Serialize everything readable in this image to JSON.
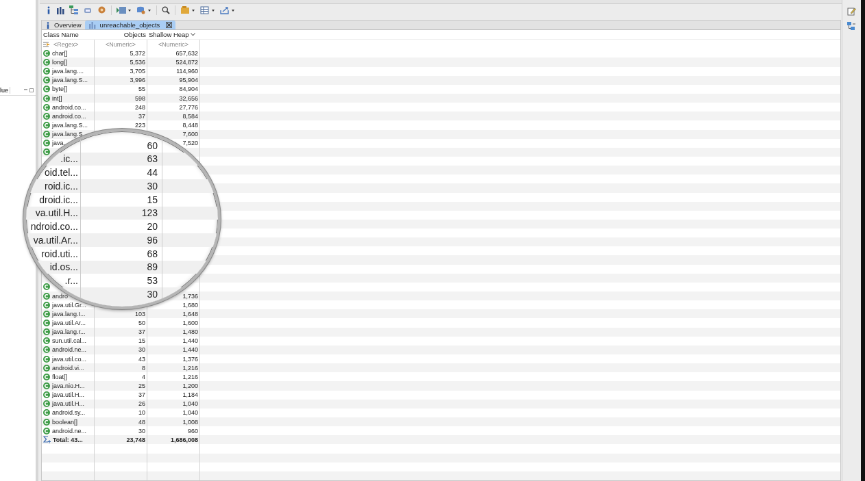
{
  "left_pane": {
    "column_label": "lue"
  },
  "tabs": [
    {
      "label": "Overview",
      "kind": "info",
      "selected": false,
      "closable": false
    },
    {
      "label": "unreachable_objects",
      "kind": "histogram",
      "selected": true,
      "closable": true
    }
  ],
  "table": {
    "columns": [
      {
        "label": "Class Name",
        "sorted": false
      },
      {
        "label": "Objects",
        "sorted": false
      },
      {
        "label": "Shallow Heap",
        "sorted": true
      }
    ],
    "filter": {
      "class_name": "<Regex>",
      "objects": "<Numeric>",
      "shallow_heap": "<Numeric>"
    },
    "rows": [
      {
        "kind": "class",
        "name": "char[]",
        "objects": "5,372",
        "shallow_heap": "657,632"
      },
      {
        "kind": "class",
        "name": "long[]",
        "objects": "5,536",
        "shallow_heap": "524,872"
      },
      {
        "kind": "class",
        "name": "java.lang....",
        "objects": "3,705",
        "shallow_heap": "114,960"
      },
      {
        "kind": "class",
        "name": "java.lang.S...",
        "objects": "3,996",
        "shallow_heap": "95,904"
      },
      {
        "kind": "class",
        "name": "byte[]",
        "objects": "55",
        "shallow_heap": "84,904"
      },
      {
        "kind": "class",
        "name": "int[]",
        "objects": "598",
        "shallow_heap": "32,656"
      },
      {
        "kind": "class",
        "name": "android.co...",
        "objects": "248",
        "shallow_heap": "27,776"
      },
      {
        "kind": "class",
        "name": "android.co...",
        "objects": "37",
        "shallow_heap": "8,584"
      },
      {
        "kind": "class",
        "name": "java.lang.S...",
        "objects": "223",
        "shallow_heap": "8,448"
      },
      {
        "kind": "class",
        "name": "java.lang.S",
        "shallow_heap": "7,600"
      },
      {
        "kind": "class",
        "name": "java.",
        "shallow_heap": "7,520"
      },
      {
        "kind": "class"
      },
      {
        "kind": "covered"
      },
      {
        "kind": "covered"
      },
      {
        "kind": "covered"
      },
      {
        "kind": "covered"
      },
      {
        "kind": "covered"
      },
      {
        "kind": "covered"
      },
      {
        "kind": "covered"
      },
      {
        "kind": "covered"
      },
      {
        "kind": "covered"
      },
      {
        "kind": "covered"
      },
      {
        "kind": "covered"
      },
      {
        "kind": "covered"
      },
      {
        "kind": "covered"
      },
      {
        "kind": "covered"
      },
      {
        "kind": "class"
      },
      {
        "kind": "class",
        "name": "andro",
        "shallow_heap": "1,736"
      },
      {
        "kind": "class",
        "name": "java.util.Gr...",
        "shallow_heap": "1,680"
      },
      {
        "kind": "class",
        "name": "java.lang.I...",
        "objects": "103",
        "shallow_heap": "1,648"
      },
      {
        "kind": "class",
        "name": "java.util.Ar...",
        "objects": "50",
        "shallow_heap": "1,600"
      },
      {
        "kind": "class",
        "name": "java.lang.r...",
        "objects": "37",
        "shallow_heap": "1,480"
      },
      {
        "kind": "class",
        "name": "sun.util.cal...",
        "objects": "15",
        "shallow_heap": "1,440"
      },
      {
        "kind": "class",
        "name": "android.ne...",
        "objects": "30",
        "shallow_heap": "1,440"
      },
      {
        "kind": "class",
        "name": "java.util.co...",
        "objects": "43",
        "shallow_heap": "1,376"
      },
      {
        "kind": "class",
        "name": "android.vi...",
        "objects": "8",
        "shallow_heap": "1,216"
      },
      {
        "kind": "class",
        "name": "float[]",
        "objects": "4",
        "shallow_heap": "1,216"
      },
      {
        "kind": "class",
        "name": "java.nio.H...",
        "objects": "25",
        "shallow_heap": "1,200"
      },
      {
        "kind": "class",
        "name": "java.util.H...",
        "objects": "37",
        "shallow_heap": "1,184"
      },
      {
        "kind": "class",
        "name": "java.util.H...",
        "objects": "26",
        "shallow_heap": "1,040"
      },
      {
        "kind": "class",
        "name": "android.sy...",
        "objects": "10",
        "shallow_heap": "1,040"
      },
      {
        "kind": "class",
        "name": "boolean[]",
        "objects": "48",
        "shallow_heap": "1,008"
      },
      {
        "kind": "class",
        "name": "android.ne...",
        "objects": "30",
        "shallow_heap": "960"
      }
    ],
    "total": {
      "label": "Total: 43...",
      "objects": "23,748",
      "shallow_heap": "1,686,008"
    }
  },
  "magnifier": {
    "rows": [
      {
        "objects": "60"
      },
      {
        "name": ".ic...",
        "objects": "63"
      },
      {
        "name": "oid.tel...",
        "objects": "44"
      },
      {
        "name": "roid.ic...",
        "objects": "30"
      },
      {
        "name": "droid.ic...",
        "objects": "15"
      },
      {
        "name": "va.util.H...",
        "objects": "123"
      },
      {
        "name": "ndroid.co...",
        "objects": "20"
      },
      {
        "name": "va.util.Ar...",
        "objects": "96"
      },
      {
        "name": "roid.uti...",
        "objects": "68"
      },
      {
        "name": "id.os...",
        "objects": "89"
      },
      {
        "name": ".r...",
        "objects": "53"
      },
      {
        "objects": "30"
      }
    ]
  }
}
